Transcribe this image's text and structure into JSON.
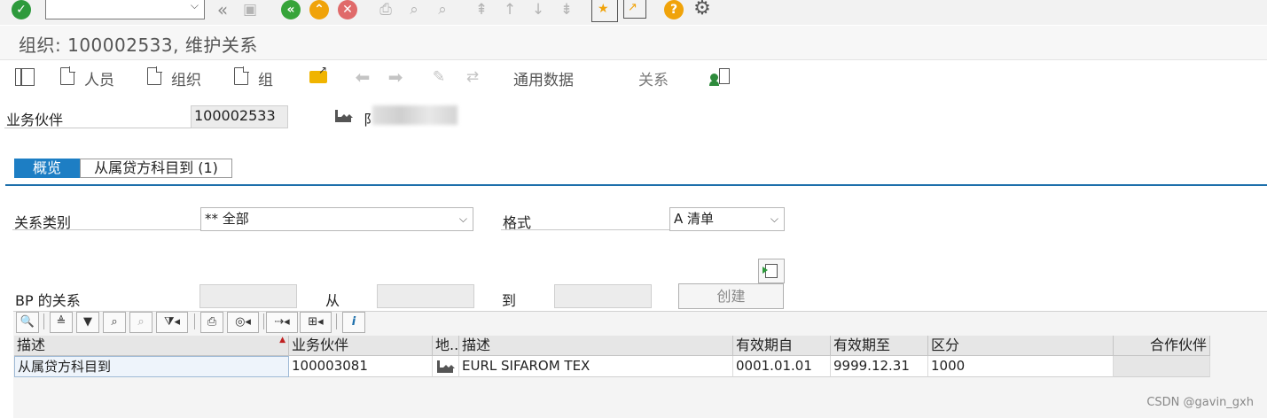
{
  "page_title": "组织: 100002533, 维护关系",
  "app_toolbar": {
    "persons_label": "人员",
    "orgs_label": "组织",
    "groups_label": "组",
    "general_data_label": "通用数据",
    "relations_label": "关系"
  },
  "header": {
    "bp_label": "业务伙伴",
    "bp_value": "100002533",
    "partner_name_fragment": "阝"
  },
  "tabs": [
    {
      "label": "概览",
      "active": true
    },
    {
      "label": "从属贷方科目到 (1)",
      "active": false
    }
  ],
  "filters": {
    "relation_category_label": "关系类别",
    "relation_category_value": "** 全部",
    "format_label": "格式",
    "format_value": "A 清单",
    "bp_relations_label": "BP 的关系",
    "from_label": "从",
    "to_label": "到",
    "create_label": "创建"
  },
  "table": {
    "columns": [
      "描述",
      "业务伙伴",
      "地...",
      "描述",
      "有效期自",
      "有效期至",
      "区分",
      "合作伙伴"
    ],
    "rows": [
      {
        "relation_desc": "从属贷方科目到",
        "partner": "100003081",
        "partner_desc": "EURL SIFAROM TEX",
        "valid_from": "0001.01.01",
        "valid_to": "9999.12.31",
        "differentiation": "1000",
        "cooperation_partner": ""
      }
    ]
  },
  "watermark": "CSDN @gavin_gxh",
  "colors": {
    "tab_active": "#1d7ec4",
    "check_green": "#2e9a3c",
    "nav_green": "#37a43a",
    "nav_orange": "#f0a30a",
    "cancel_red": "#e06a6a",
    "help_orange": "#f0a30a"
  }
}
